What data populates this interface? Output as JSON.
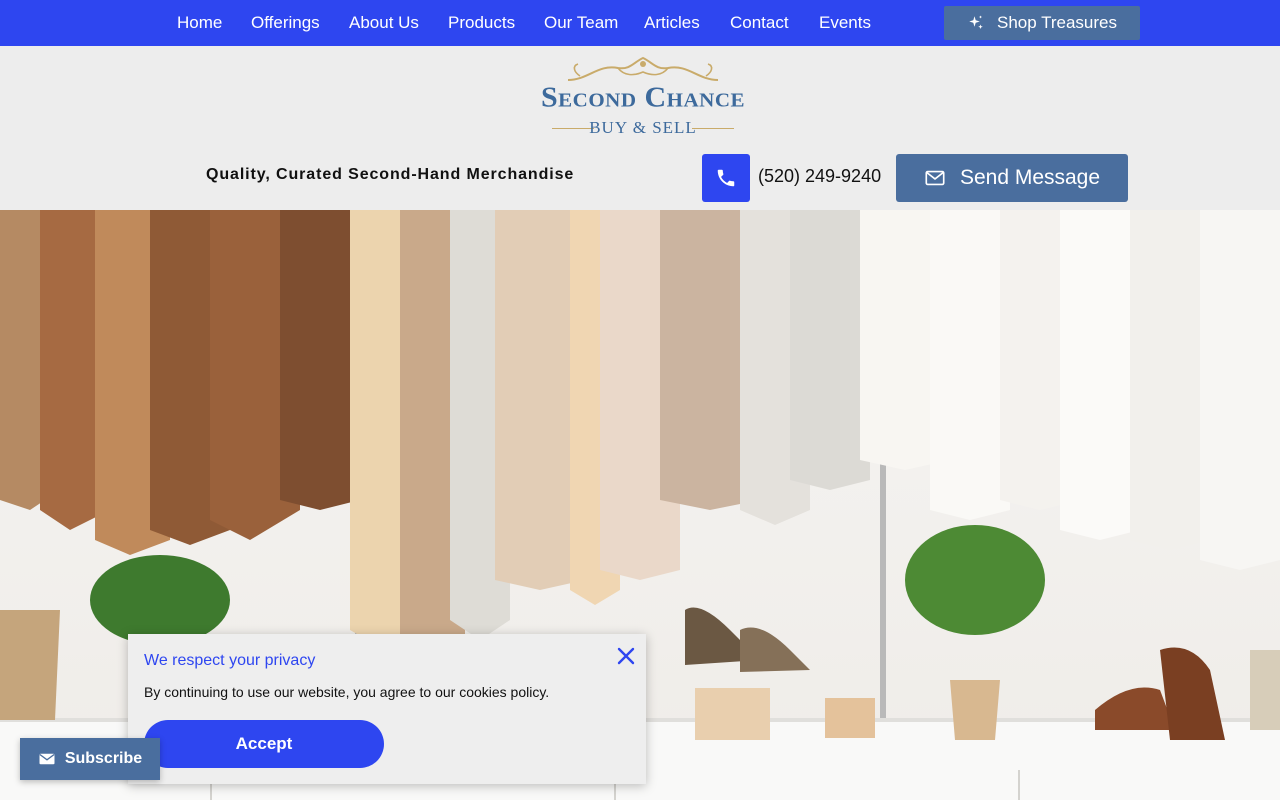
{
  "nav": {
    "items": [
      {
        "label": "Home"
      },
      {
        "label": "Offerings"
      },
      {
        "label": "About Us"
      },
      {
        "label": "Products"
      },
      {
        "label": "Our Team"
      },
      {
        "label": "Articles"
      },
      {
        "label": "Contact"
      },
      {
        "label": "Events"
      }
    ],
    "shop_button": {
      "label": "Shop Treasures",
      "icon": "sparkle-icon"
    }
  },
  "logo": {
    "line1": "Second Chance",
    "line2": "BUY & SELL"
  },
  "header": {
    "tagline": "Quality, Curated Second-Hand Merchandise",
    "phone": "(520) 249-9240",
    "phone_icon": "phone-icon",
    "message_button": {
      "label": "Send Message",
      "icon": "mail-icon"
    }
  },
  "hero": {
    "image_description_icon": "clothing-rack-photo"
  },
  "cookie_banner": {
    "title": "We respect your privacy",
    "text": "By continuing to use our website, you agree to our cookies policy.",
    "accept_label": "Accept",
    "close_icon": "close-icon"
  },
  "subscribe": {
    "label": "Subscribe",
    "icon": "mail-icon"
  },
  "colors": {
    "primary_blue": "#2e46f0",
    "slate_blue": "#4a6e9e",
    "background": "#ededed",
    "logo_blue": "#3d6a9c",
    "logo_gold": "#c9ab6a"
  }
}
